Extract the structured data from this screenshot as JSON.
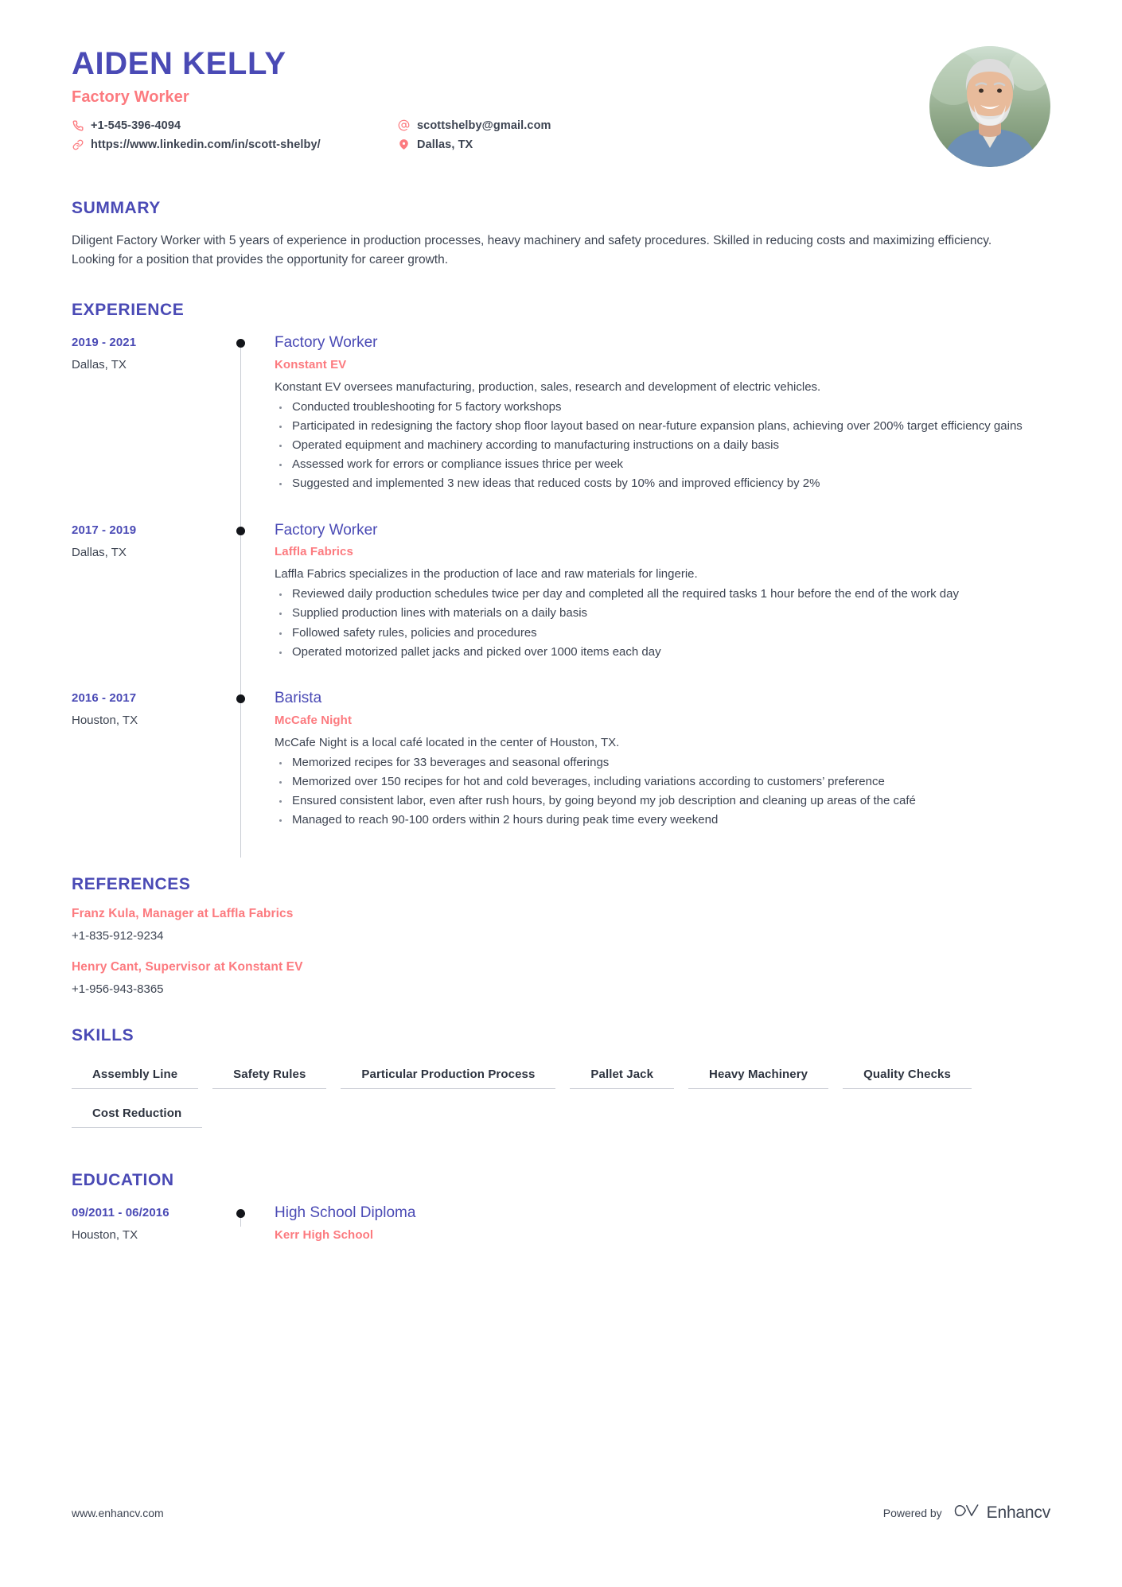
{
  "theme": {
    "primary": "#4a4ab5",
    "accent": "#fc7a7f",
    "text": "#3d4452"
  },
  "header": {
    "name": "AIDEN KELLY",
    "job_title": "Factory Worker",
    "contacts": {
      "phone": "+1-545-396-4094",
      "linkedin": "https://www.linkedin.com/in/scott-shelby/",
      "email": "scottshelby@gmail.com",
      "location": "Dallas, TX"
    },
    "icons": {
      "phone": "phone-icon",
      "link": "link-icon",
      "email": "at-sign-icon",
      "location": "map-pin-icon"
    }
  },
  "summary": {
    "title": "SUMMARY",
    "text": "Diligent Factory Worker with 5 years of experience in production processes, heavy machinery and safety procedures. Skilled in reducing costs and maximizing efficiency. Looking for a position that provides the opportunity for career growth."
  },
  "experience": {
    "title": "EXPERIENCE",
    "items": [
      {
        "dates": "2019 - 2021",
        "location": "Dallas, TX",
        "role": "Factory Worker",
        "company": "Konstant EV",
        "description": "Konstant EV oversees manufacturing, production, sales, research and development of electric vehicles.",
        "bullets": [
          "Conducted troubleshooting for 5 factory workshops",
          "Participated in redesigning the factory shop floor layout based on near-future expansion plans, achieving over 200% target efficiency gains",
          "Operated equipment and machinery according to manufacturing instructions on a daily basis",
          "Assessed work for errors or compliance issues thrice per week",
          "Suggested and implemented 3 new ideas that reduced costs by 10% and improved efficiency by 2%"
        ]
      },
      {
        "dates": "2017 - 2019",
        "location": "Dallas, TX",
        "role": "Factory Worker",
        "company": "Laffla Fabrics",
        "description": "Laffla Fabrics specializes in the production of lace and raw materials for lingerie.",
        "bullets": [
          "Reviewed daily production schedules twice per day and completed all the required tasks 1 hour before the end of the work day",
          "Supplied production lines with materials on a daily basis",
          "Followed safety rules, policies and procedures",
          "Operated motorized pallet jacks and picked over 1000 items each day"
        ]
      },
      {
        "dates": "2016 - 2017",
        "location": "Houston, TX",
        "role": "Barista",
        "company": "McCafe Night",
        "description": "McCafe Night is a local café located in the center of Houston, TX.",
        "bullets": [
          "Memorized recipes for 33 beverages and seasonal offerings",
          "Memorized over 150 recipes for hot and cold beverages, including variations according to customers’ preference",
          "Ensured consistent labor, even after rush hours, by going beyond my job description and cleaning up areas of the café",
          "Managed to reach 90-100 orders within 2 hours during peak time every weekend"
        ]
      }
    ]
  },
  "references": {
    "title": "REFERENCES",
    "items": [
      {
        "name": "Franz Kula, Manager at Laffla Fabrics",
        "phone": "+1-835-912-9234"
      },
      {
        "name": "Henry Cant, Supervisor at Konstant EV",
        "phone": "+1-956-943-8365"
      }
    ]
  },
  "skills": {
    "title": "SKILLS",
    "items": [
      "Assembly Line",
      "Safety Rules",
      "Particular Production Process",
      "Pallet Jack",
      "Heavy Machinery",
      "Quality Checks",
      "Cost Reduction"
    ]
  },
  "education": {
    "title": "EDUCATION",
    "items": [
      {
        "dates": "09/2011 - 06/2016",
        "location": "Houston, TX",
        "degree": "High School Diploma",
        "school": "Kerr High School"
      }
    ]
  },
  "footer": {
    "url": "www.enhancv.com",
    "powered_by": "Powered by",
    "brand": "Enhancv"
  }
}
